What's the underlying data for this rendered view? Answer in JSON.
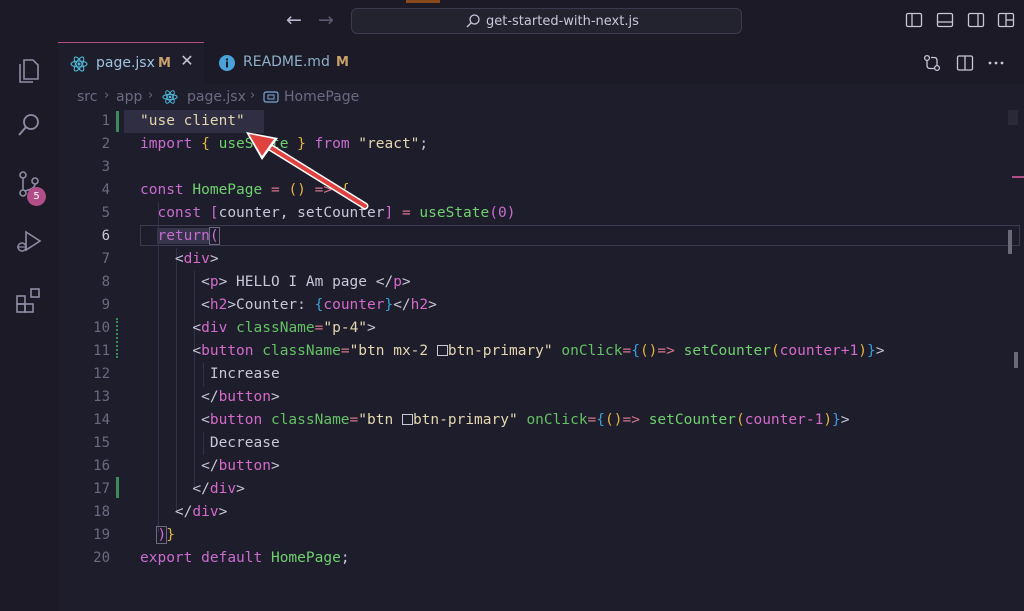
{
  "titlebar": {
    "search_text": "get-started-with-next.js"
  },
  "activity": {
    "source_control_badge": "5"
  },
  "tabs": [
    {
      "label": "page.jsx",
      "status": "M",
      "icon": "react-icon"
    },
    {
      "label": "README.md",
      "status": "M",
      "icon": "info-icon"
    }
  ],
  "breadcrumb": {
    "items": [
      "src",
      "app",
      "page.jsx",
      "HomePage"
    ]
  },
  "editor": {
    "line_numbers": [
      "1",
      "2",
      "3",
      "4",
      "5",
      "6",
      "7",
      "8",
      "9",
      "10",
      "11",
      "12",
      "13",
      "14",
      "15",
      "16",
      "17",
      "18",
      "19",
      "20"
    ],
    "current_line": "6",
    "tokens": {
      "l1_str": "\"use client\"",
      "l2_import": "import",
      "l2_ob": "{",
      "l2_usestate": "useState",
      "l2_cb": "}",
      "l2_from": "from",
      "l2_react": "\"react\"",
      "l2_semi": ";",
      "l4_const": "const",
      "l4_name": "HomePage",
      "l4_eq": "=",
      "l4_parens": "()",
      "l4_arrow": "=>",
      "l4_ob": "{",
      "l5_const": "const",
      "l5_lb": "[",
      "l5_vars": "counter, setCounter",
      "l5_rb": "]",
      "l5_eq": "=",
      "l5_fn": "useState",
      "l5_op": "(",
      "l5_zero": "0",
      "l5_cp": ")",
      "l6_return": "return",
      "l6_op": "(",
      "l7_lt": "<",
      "l7_div": "div",
      "l7_gt": ">",
      "l8_open": "<",
      "l8_p": "p",
      "l8_gtxt": "> HELLO I Am page </",
      "l8_p2": "p",
      "l8_gt": ">",
      "l9_lt": "<",
      "l9_h2": "h2",
      "l9_txt": ">Counter: ",
      "l9_ob": "{",
      "l9_counter": "counter",
      "l9_cb": "}",
      "l9_close": "</",
      "l9_h2b": "h2",
      "l9_gt": ">",
      "l10_lt": "<",
      "l10_div": "div",
      "l10_attr": "className",
      "l10_eq": "=",
      "l10_val": "\"p-4\"",
      "l10_gt": ">",
      "l11_lt": "<",
      "l11_btn": "button",
      "l11_attr": "className",
      "l11_eq": "=",
      "l11_val1": "\"btn mx-2 ",
      "l11_val2": "btn-primary\"",
      "l11_onclick": "onClick",
      "l11_eq2": "=",
      "l11_ob": "{",
      "l11_pp": "()",
      "l11_arrow": "=>",
      "l11_fn": "setCounter",
      "l11_op": "(",
      "l11_expr": "counter+1",
      "l11_cp": ")",
      "l11_cb": "}",
      "l11_gt": ">",
      "l12_txt": "Increase",
      "l13_close": "</",
      "l13_btn": "button",
      "l13_gt": ">",
      "l14_lt": "<",
      "l14_btn": "button",
      "l14_attr": "className",
      "l14_eq": "=",
      "l14_val1": "\"btn ",
      "l14_val2": "btn-primary\"",
      "l14_onclick": "onClick",
      "l14_eq2": "=",
      "l14_ob": "{",
      "l14_pp": "()",
      "l14_arrow": "=>",
      "l14_fn": "setCounter",
      "l14_op": "(",
      "l14_expr": "counter-1",
      "l14_cp": ")",
      "l14_cb": "}",
      "l14_gt": ">",
      "l15_txt": "Decrease",
      "l16_close": "</",
      "l16_btn": "button",
      "l16_gt": ">",
      "l17_close": "</",
      "l17_div": "div",
      "l17_gt": ">",
      "l18_close": "</",
      "l18_div": "div",
      "l18_gt": ">",
      "l19_cp": ")",
      "l19_cb": "}",
      "l20_export": "export",
      "l20_default": "default",
      "l20_name": "HomePage",
      "l20_semi": ";"
    }
  },
  "colors": {
    "accent": "#b14d87",
    "annotation_arrow": "#e0433f",
    "git_modified": "#3d8a59"
  }
}
